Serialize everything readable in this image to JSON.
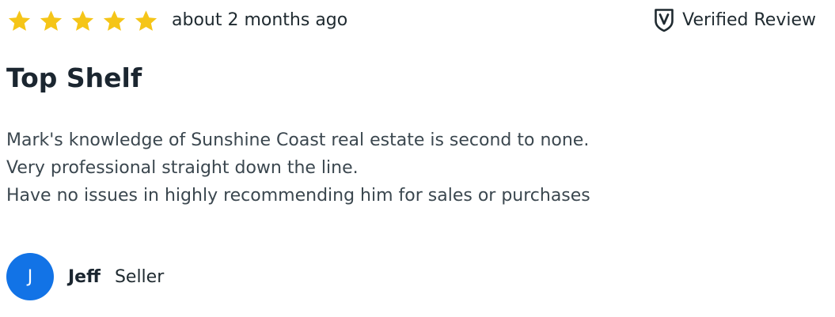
{
  "review": {
    "rating": 5,
    "rating_max": 5,
    "time_ago": "about 2 months ago",
    "verified_label": "Verified Review",
    "title": "Top Shelf",
    "body_lines": [
      "Mark's knowledge of Sunshine Coast real estate is second to none.",
      "Very professional straight down the line.",
      "Have no issues in highly recommending him for sales or purchases"
    ],
    "reviewer": {
      "initial": "J",
      "name": "Jeff",
      "role": "Seller"
    }
  },
  "icons": {
    "star": "star-icon",
    "verified": "verified-shield-icon"
  },
  "colors": {
    "star": "#F5C518",
    "avatar": "#1273E6",
    "text_dark": "#1B2630",
    "text_body": "#3B474F"
  }
}
